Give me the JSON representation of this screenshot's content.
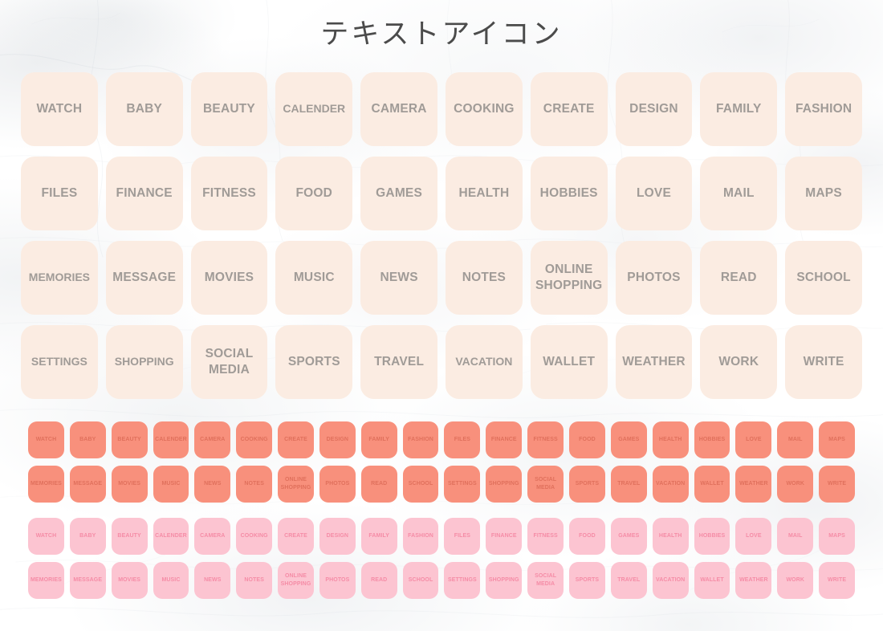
{
  "page": {
    "title": "テキストアイコン",
    "background": "white-marble"
  },
  "colors": {
    "large_tile_bg": "#FBECE2",
    "large_tile_text": "#A09B97",
    "coral_tile_bg": "#F8907C",
    "coral_tile_text": "#E0705C",
    "pink_tile_bg": "#FCC4D1",
    "pink_tile_text": "#F58CA6",
    "title_text": "#4B4B4B",
    "page_bg": "#FAFAFA"
  },
  "large_grid": {
    "columns": 10,
    "rows": 4,
    "tiles": [
      {
        "label": "WATCH"
      },
      {
        "label": "BABY"
      },
      {
        "label": "BEAUTY"
      },
      {
        "label": "CALENDER"
      },
      {
        "label": "CAMERA"
      },
      {
        "label": "COOKING"
      },
      {
        "label": "CREATE"
      },
      {
        "label": "DESIGN"
      },
      {
        "label": "FAMILY"
      },
      {
        "label": "FASHION"
      },
      {
        "label": "FILES"
      },
      {
        "label": "FINANCE"
      },
      {
        "label": "FITNESS"
      },
      {
        "label": "FOOD"
      },
      {
        "label": "GAMES"
      },
      {
        "label": "HEALTH"
      },
      {
        "label": "HOBBIES"
      },
      {
        "label": "LOVE"
      },
      {
        "label": "MAIL"
      },
      {
        "label": "MAPS"
      },
      {
        "label": "MEMORIES"
      },
      {
        "label": "MESSAGE"
      },
      {
        "label": "MOVIES"
      },
      {
        "label": "MUSIC"
      },
      {
        "label": "NEWS"
      },
      {
        "label": "NOTES"
      },
      {
        "label": "ONLINE\nSHOPPING"
      },
      {
        "label": "PHOTOS"
      },
      {
        "label": "READ"
      },
      {
        "label": "SCHOOL"
      },
      {
        "label": "SETTINGS"
      },
      {
        "label": "SHOPPING"
      },
      {
        "label": "SOCIAL\nMEDIA"
      },
      {
        "label": "SPORTS"
      },
      {
        "label": "TRAVEL"
      },
      {
        "label": "VACATION"
      },
      {
        "label": "WALLET"
      },
      {
        "label": "WEATHER"
      },
      {
        "label": "WORK"
      },
      {
        "label": "WRITE"
      }
    ]
  },
  "small_rows": [
    {
      "id": "coral-row-1",
      "color": "coral",
      "tiles": [
        {
          "label": "WATCH"
        },
        {
          "label": "BABY"
        },
        {
          "label": "BEAUTY"
        },
        {
          "label": "CALENDER"
        },
        {
          "label": "CAMERA"
        },
        {
          "label": "COOKING"
        },
        {
          "label": "CREATE"
        },
        {
          "label": "DESIGN"
        },
        {
          "label": "FAMILY"
        },
        {
          "label": "FASHION"
        },
        {
          "label": "FILES"
        },
        {
          "label": "FINANCE"
        },
        {
          "label": "FITNESS"
        },
        {
          "label": "FOOD"
        },
        {
          "label": "GAMES"
        },
        {
          "label": "HEALTH"
        },
        {
          "label": "HOBBIES"
        },
        {
          "label": "LOVE"
        },
        {
          "label": "MAIL"
        },
        {
          "label": "MAPS"
        }
      ]
    },
    {
      "id": "coral-row-2",
      "color": "coral",
      "tiles": [
        {
          "label": "MEMORIES"
        },
        {
          "label": "MESSAGE"
        },
        {
          "label": "MOVIES"
        },
        {
          "label": "MUSIC"
        },
        {
          "label": "NEWS"
        },
        {
          "label": "NOTES"
        },
        {
          "label": "ONLINE\nSHOPPING"
        },
        {
          "label": "PHOTOS"
        },
        {
          "label": "READ"
        },
        {
          "label": "SCHOOL"
        },
        {
          "label": "SETTINGS"
        },
        {
          "label": "SHOPPING"
        },
        {
          "label": "SOCIAL\nMEDIA"
        },
        {
          "label": "SPORTS"
        },
        {
          "label": "TRAVEL"
        },
        {
          "label": "VACATION"
        },
        {
          "label": "WALLET"
        },
        {
          "label": "WEATHER"
        },
        {
          "label": "WORK"
        },
        {
          "label": "WRITE"
        }
      ]
    },
    {
      "id": "pink-row-1",
      "color": "pink",
      "tiles": [
        {
          "label": "WATCH"
        },
        {
          "label": "BABY"
        },
        {
          "label": "BEAUTY"
        },
        {
          "label": "CALENDER"
        },
        {
          "label": "CAMERA"
        },
        {
          "label": "COOKING"
        },
        {
          "label": "CREATE"
        },
        {
          "label": "DESIGN"
        },
        {
          "label": "FAMILY"
        },
        {
          "label": "FASHION"
        },
        {
          "label": "FILES"
        },
        {
          "label": "FINANCE"
        },
        {
          "label": "FITNESS"
        },
        {
          "label": "FOOD"
        },
        {
          "label": "GAMES"
        },
        {
          "label": "HEALTH"
        },
        {
          "label": "HOBBIES"
        },
        {
          "label": "LOVE"
        },
        {
          "label": "MAIL"
        },
        {
          "label": "MAPS"
        }
      ]
    },
    {
      "id": "pink-row-2",
      "color": "pink",
      "tiles": [
        {
          "label": "MEMORIES"
        },
        {
          "label": "MESSAGE"
        },
        {
          "label": "MOVIES"
        },
        {
          "label": "MUSIC"
        },
        {
          "label": "NEWS"
        },
        {
          "label": "NOTES"
        },
        {
          "label": "ONLINE\nSHOPPING"
        },
        {
          "label": "PHOTOS"
        },
        {
          "label": "READ"
        },
        {
          "label": "SCHOOL"
        },
        {
          "label": "SETTINGS"
        },
        {
          "label": "SHOPPING"
        },
        {
          "label": "SOCIAL\nMEDIA"
        },
        {
          "label": "SPORTS"
        },
        {
          "label": "TRAVEL"
        },
        {
          "label": "VACATION"
        },
        {
          "label": "WALLET"
        },
        {
          "label": "WEATHER"
        },
        {
          "label": "WORK"
        },
        {
          "label": "WRITE"
        }
      ]
    }
  ]
}
